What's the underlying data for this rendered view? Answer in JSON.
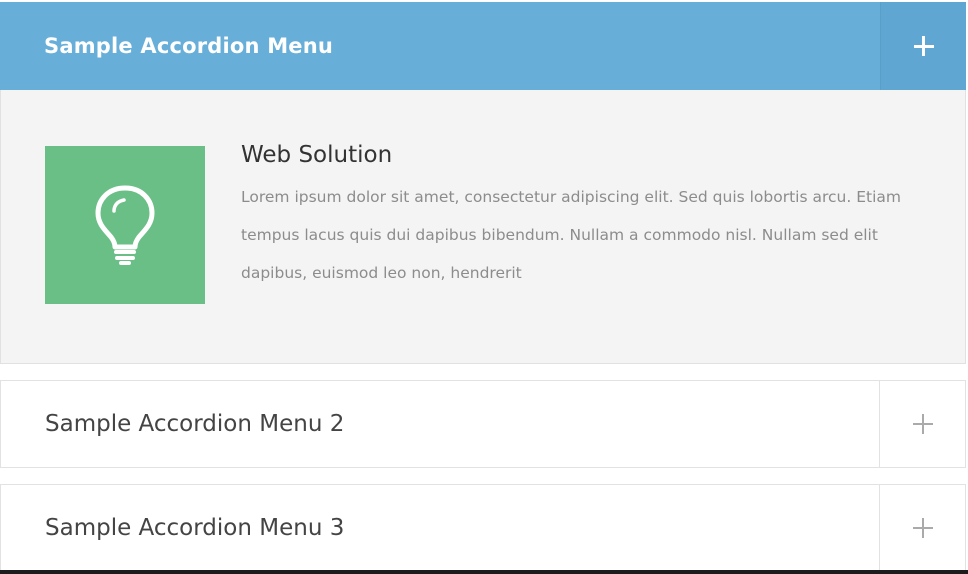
{
  "accordion": {
    "items": [
      {
        "title": "Sample Accordion Menu",
        "toggle_icon": "plus-icon",
        "expanded": true,
        "panel": {
          "icon": "lightbulb-icon",
          "heading": "Web Solution",
          "body": "Lorem ipsum dolor sit amet, consectetur adipiscing elit. Sed quis lobortis arcu. Etiam tempus lacus quis dui dapibus bibendum. Nullam a commodo nisl. Nullam sed elit dapibus, euismod leo non, hendrerit"
        }
      },
      {
        "title": "Sample Accordion Menu 2",
        "toggle_icon": "plus-icon",
        "expanded": false
      },
      {
        "title": "Sample Accordion Menu 3",
        "toggle_icon": "plus-icon",
        "expanded": false
      }
    ]
  },
  "colors": {
    "active_header": "#67aed8",
    "icon_tile": "#6abf86",
    "panel_bg": "#f4f4f4"
  }
}
